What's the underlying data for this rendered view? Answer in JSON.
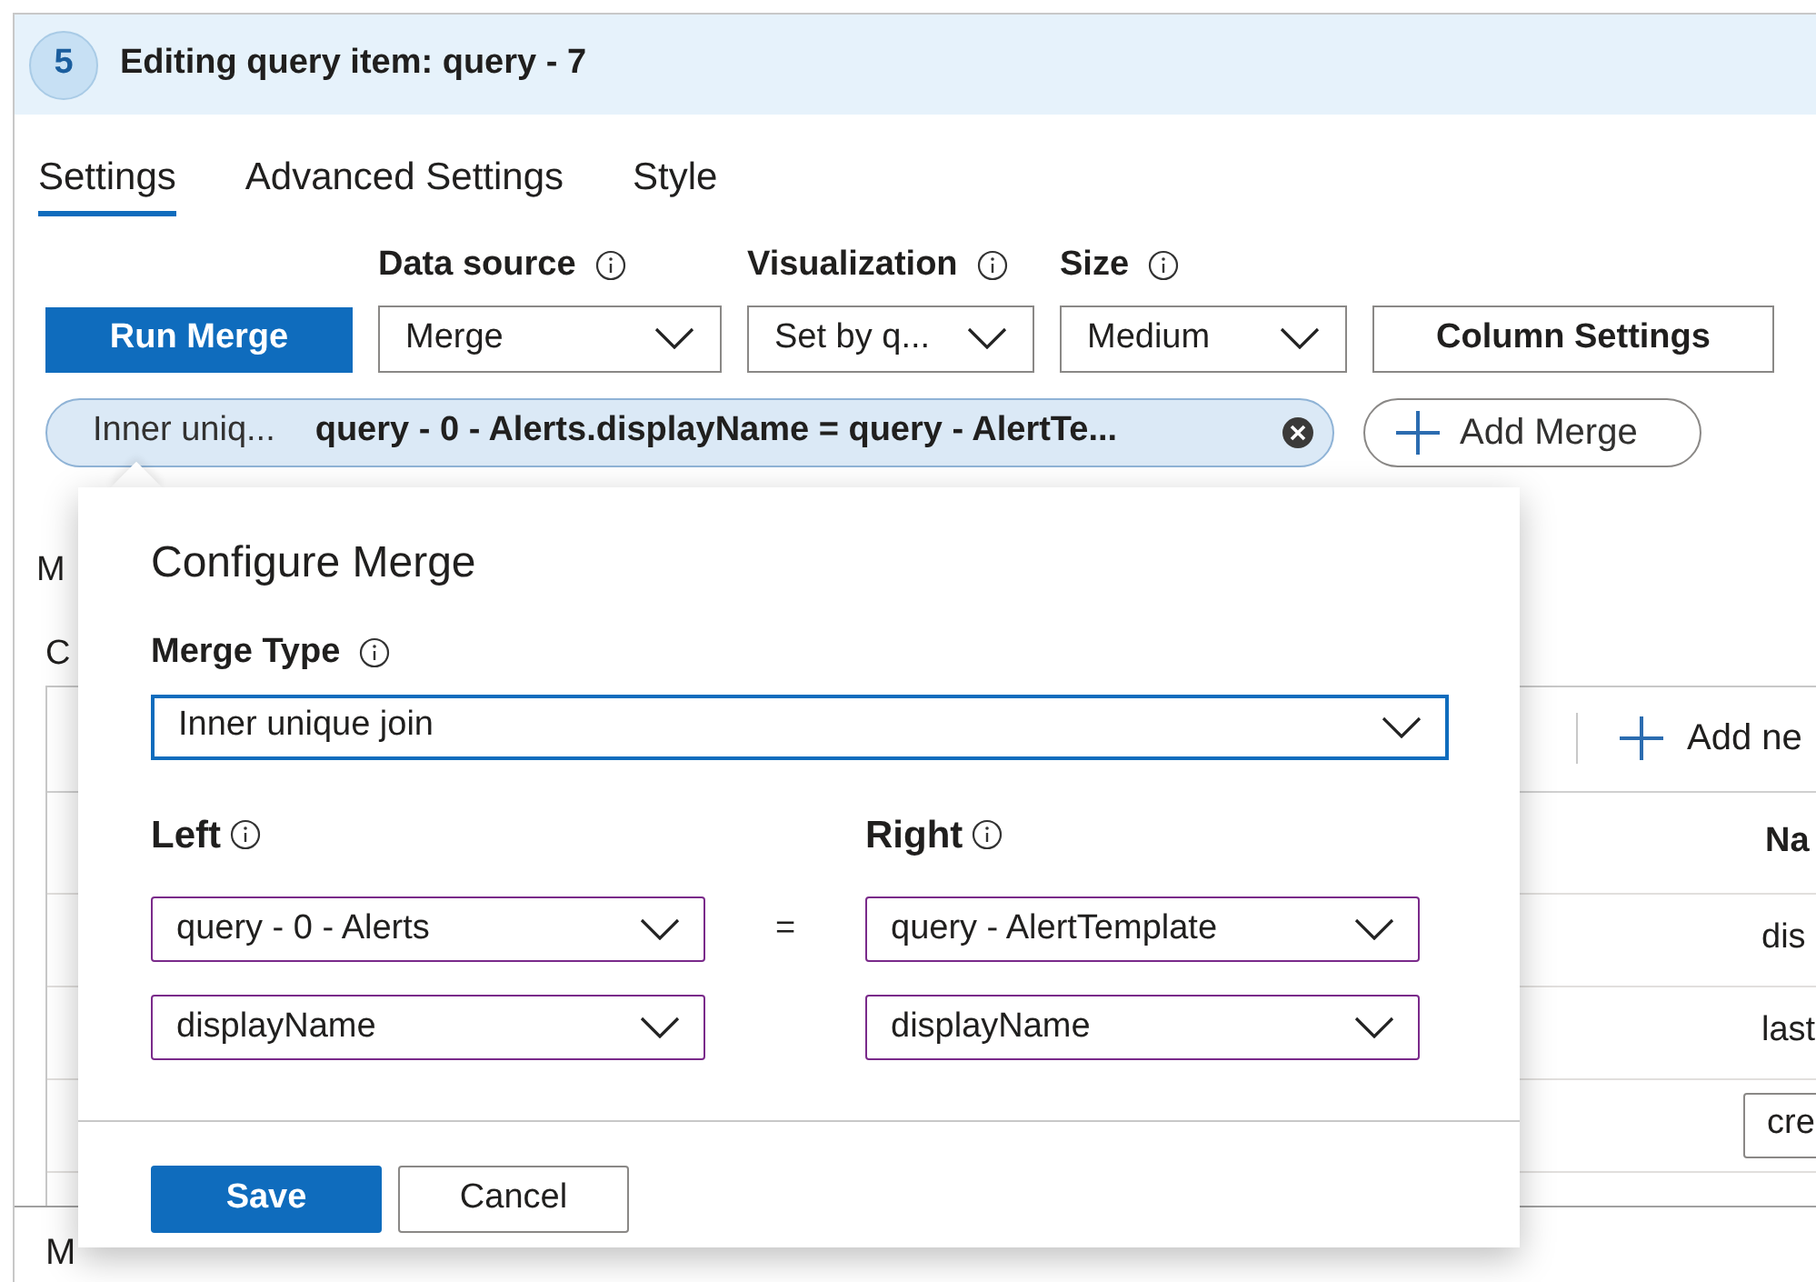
{
  "header": {
    "step": "5",
    "title": "Editing query item: query - 7"
  },
  "tabs": [
    {
      "label": "Settings",
      "selected": true
    },
    {
      "label": "Advanced Settings",
      "selected": false
    },
    {
      "label": "Style",
      "selected": false
    }
  ],
  "run_button": "Run Merge",
  "dropdowns": [
    {
      "label": "Data source",
      "value": "Merge"
    },
    {
      "label": "Visualization",
      "value": "Set by q..."
    },
    {
      "label": "Size",
      "value": "Medium"
    }
  ],
  "column_settings_button": "Column Settings",
  "merge_pill": {
    "type": "Inner uniq...",
    "expression": "query - 0 - Alerts.displayName = query - AlertTe..."
  },
  "add_merge_button": "Add Merge",
  "background": {
    "section_label": "M",
    "subsection_label": "C",
    "toolbar_button": "Add ne",
    "column_header": "Na",
    "rows": [
      {
        "kind": "text",
        "value": "dis"
      },
      {
        "kind": "text",
        "value": "last"
      },
      {
        "kind": "input",
        "value": "cre"
      }
    ],
    "footer_label": "M"
  },
  "dialog": {
    "title": "Configure Merge",
    "merge_type": {
      "label": "Merge Type",
      "value": "Inner unique join"
    },
    "left_label": "Left",
    "right_label": "Right",
    "equals": "=",
    "pairs": [
      {
        "left": "query - 0 - Alerts",
        "right": "query - AlertTemplate"
      },
      {
        "left": "displayName",
        "right": "displayName"
      }
    ],
    "buttons": [
      {
        "label": "Save",
        "primary": true
      },
      {
        "label": "Cancel",
        "primary": false
      }
    ]
  }
}
